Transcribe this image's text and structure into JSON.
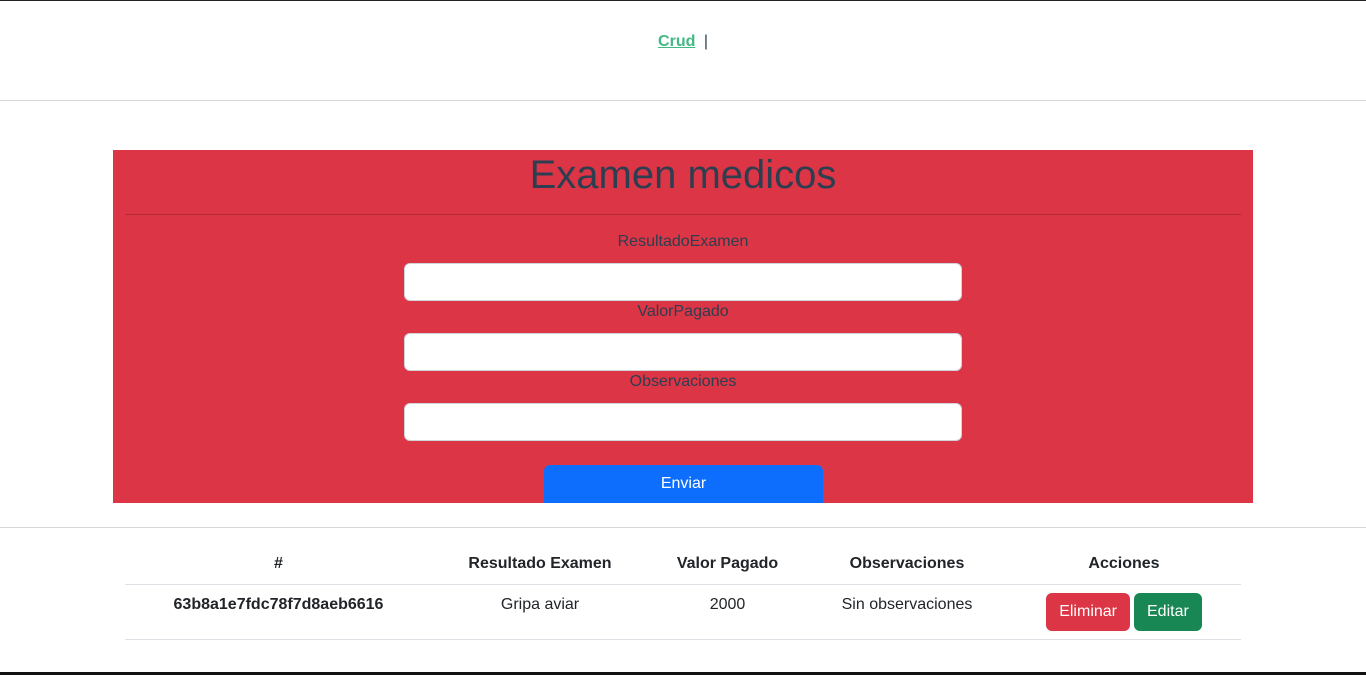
{
  "nav": {
    "link_label": "Crud",
    "separator": "|"
  },
  "form": {
    "title": "Examen medicos",
    "fields": [
      {
        "label": "ResultadoExamen",
        "value": "",
        "placeholder": ""
      },
      {
        "label": "ValorPagado",
        "value": "",
        "placeholder": ""
      },
      {
        "label": "Observaciones",
        "value": "",
        "placeholder": ""
      }
    ],
    "submit_label": "Enviar"
  },
  "table": {
    "headers": [
      "#",
      "Resultado Examen",
      "Valor Pagado",
      "Observaciones",
      "Acciones"
    ],
    "rows": [
      {
        "id": "63b8a1e7fdc78f7d8aeb6616",
        "resultado": "Gripa aviar",
        "valor": "2000",
        "observaciones": "Sin observaciones",
        "delete_label": "Eliminar",
        "edit_label": "Editar"
      }
    ]
  },
  "colors": {
    "panel": "#dc3545",
    "submit": "#0d6efd",
    "delete": "#dc3545",
    "edit": "#198754",
    "nav_link": "#42b983"
  }
}
